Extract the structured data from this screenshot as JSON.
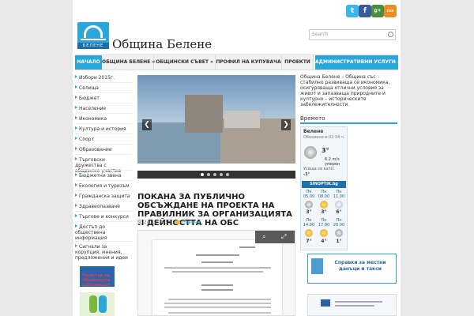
{
  "header": {
    "site_title": "Община Белене",
    "logo_band_text": "БЕЛЕНЕ",
    "search_placeholder": "Search",
    "social": {
      "twitter": "t",
      "facebook": "f",
      "googleplus": "g+",
      "rss": "rss"
    }
  },
  "nav": {
    "items": [
      {
        "label": "НАЧАЛО"
      },
      {
        "label": "ОБЩИНА БЕЛЕНЕ »"
      },
      {
        "label": "ОБЩИНСКИ СЪВЕТ »"
      },
      {
        "label": "ПРОФИЛ НА КУПУВАЧА"
      },
      {
        "label": "ПРОЕКТИ"
      },
      {
        "label": "АДМИНИСТРАТИВНИ УСЛУГИ »"
      }
    ]
  },
  "left_sidebar": {
    "items": [
      "Избори 2015г.",
      "Селища",
      "Бюджет",
      "Население",
      "Икономика",
      "Култура и история",
      "Спорт",
      "Образование",
      "Търговски дружества с общинско участие",
      "Бюджетни звена",
      "Екология и туризъм",
      "Гражданска защита",
      "Здравеопазване",
      "Търгове и конкурси",
      "Достъп до обществена информация",
      "Сигнали за корупция, мнения, предложения и идеи"
    ],
    "banner1_text": "Регистър на общинската собственост"
  },
  "slider": {
    "prev": "❮",
    "next": "❯",
    "dots": 5
  },
  "article": {
    "title": "ПОКАНА ЗА ПУБЛИЧНО ОБСЪЖДАНЕ НА ПРОЕКТА НА ПРАВИЛНИК ЗА ОРГАНИЗАЦИЯТА И ДЕЙНОСТТА НА ОБС",
    "date": "24.11.2015",
    "category": "Новини"
  },
  "right_sidebar": {
    "intro": "Община Белене – Община със стабилно развиваща се икономика, осигуряваща отлични условия за живот и запазваща природните и културно – историческите забележителности.",
    "weather_heading": "Времето",
    "weather": {
      "city": "Белене",
      "updated": "Обновено в 02:34 ч.",
      "temp": "3°",
      "wind": "6.2 m/s",
      "wind_desc": "умерен",
      "feels_label": "Усеща се като:",
      "feels_value": "-1°",
      "provider": "SINOPTIK.bg",
      "forecast_row1": [
        {
          "day": "Пн",
          "time": "05.00",
          "temp": "3°"
        },
        {
          "day": "Пн",
          "time": "08.00",
          "temp": "3°"
        },
        {
          "day": "Пн",
          "time": "11.00",
          "temp": "6°"
        }
      ],
      "forecast_row2": [
        {
          "day": "Пн",
          "time": "14.00",
          "temp": "7°"
        },
        {
          "day": "Пн",
          "time": "17.00",
          "temp": "4°"
        },
        {
          "day": "Пн",
          "time": "20.00",
          "temp": "1°"
        }
      ]
    },
    "banner_taxes": "Справки за местни данъци и такси"
  }
}
